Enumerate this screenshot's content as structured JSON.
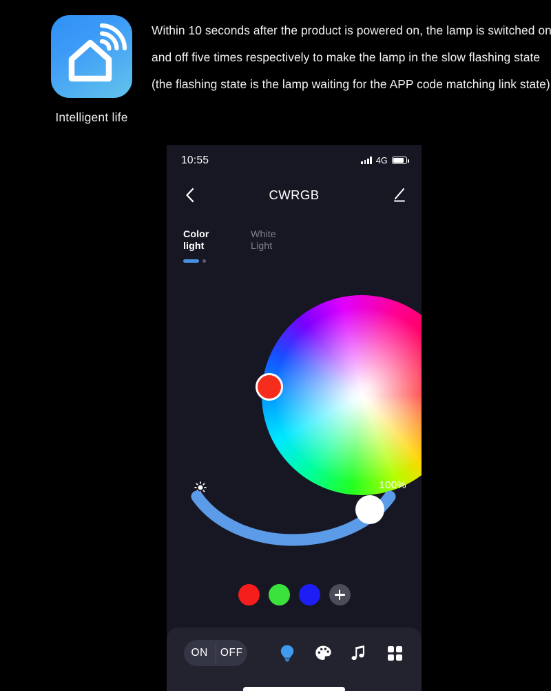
{
  "promo": {
    "app_icon_name": "house-wifi-icon",
    "app_label": "Intelligent life",
    "instruction_lines": [
      "Within 10 seconds after the product is powered on, the lamp is switched on",
      "and off five times respectively to make the lamp in the slow flashing state",
      "(the flashing state is the lamp waiting for the APP code matching link state)"
    ]
  },
  "phone": {
    "status_bar": {
      "time": "10:55",
      "network": "4G",
      "signal_icon": "signal-bars-icon",
      "battery_icon": "battery-icon"
    },
    "nav": {
      "back_icon": "chevron-left-icon",
      "title": "CWRGB",
      "edit_icon": "pencil-edit-icon"
    },
    "tabs": [
      {
        "label": "Color\nlight",
        "line1": "Color",
        "line2": "light",
        "active": true
      },
      {
        "label": "White\nLight",
        "line1": "White",
        "line2": "Light",
        "active": false
      }
    ],
    "color_wheel": {
      "name": "color-wheel",
      "selected_color": "#f42d1c",
      "knob_icon": "color-selector-knob"
    },
    "brightness": {
      "icon": "brightness-sun-icon",
      "value": "100%",
      "slider_name": "brightness-arc-slider",
      "track_color": "#5b9be8",
      "knob_color": "#ffffff"
    },
    "presets": [
      {
        "name": "preset-red",
        "color": "#f61d1d"
      },
      {
        "name": "preset-green",
        "color": "#3ce23c"
      },
      {
        "name": "preset-blue",
        "color": "#1d1df6"
      },
      {
        "name": "preset-add",
        "color": "#4b4c58",
        "icon": "plus-icon"
      }
    ],
    "bottom_bar": {
      "power": {
        "on_label": "ON",
        "off_label": "OFF"
      },
      "icons": [
        {
          "name": "bulb-icon",
          "active": true,
          "color": "#3f9bee"
        },
        {
          "name": "palette-icon",
          "active": false,
          "color": "#ffffff"
        },
        {
          "name": "music-note-icon",
          "active": false,
          "color": "#ffffff"
        },
        {
          "name": "grid-scenes-icon",
          "active": false,
          "color": "#ffffff"
        }
      ],
      "home_indicator": "home-indicator"
    }
  }
}
